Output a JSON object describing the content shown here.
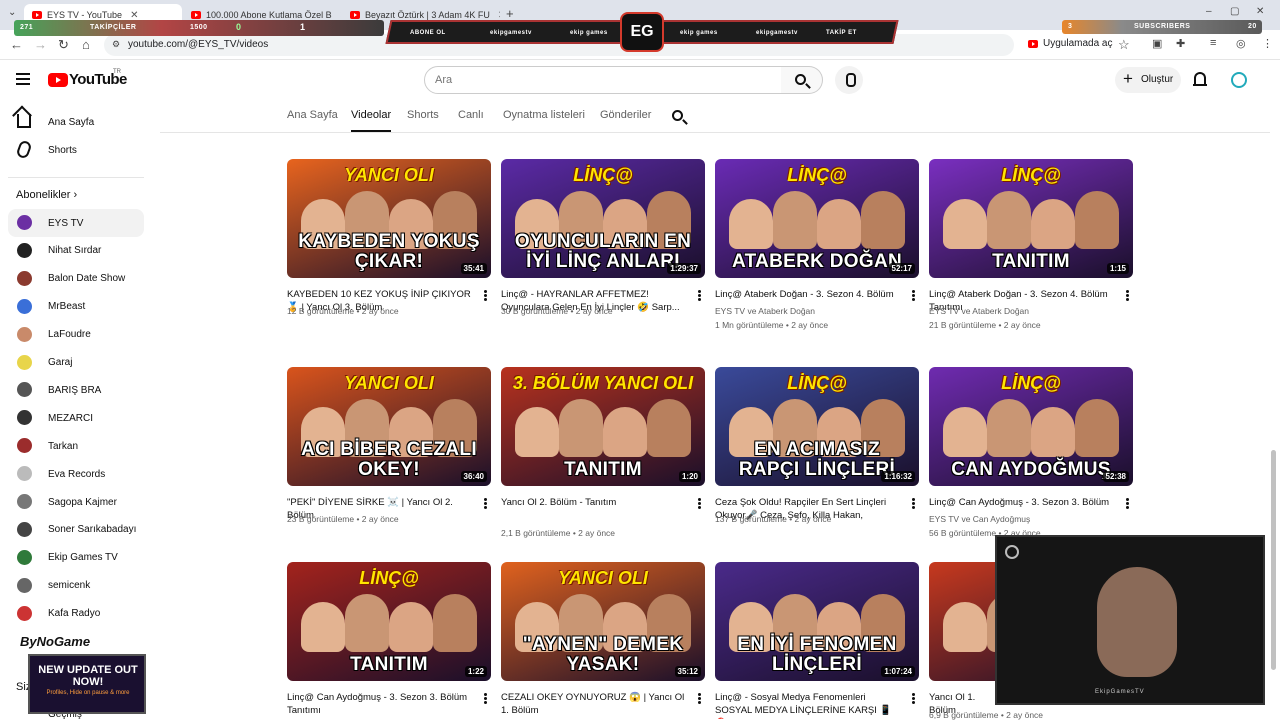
{
  "browser": {
    "tabs": [
      {
        "title": "EYS TV - YouTube",
        "active": true
      },
      {
        "title": "100.000 Abone Kutlama Özel B",
        "active": false
      },
      {
        "title": "Beyazıt Öztürk | 3 Adam 4K FU",
        "active": false
      }
    ],
    "new_tab": "+",
    "url": "youtube.com/@EYS_TV/videos",
    "app_button": "Uygulamada aç"
  },
  "overlay": {
    "followers_label": "TAKİPÇİLER",
    "followers_count": "1500",
    "followers_left": "271",
    "counter_a": "0",
    "counter_b": "1",
    "center_left": "ABONE OL",
    "center_items": [
      "ekipgamestv",
      "ekip games",
      "ekip games",
      "ekipgamestv"
    ],
    "center_right": "TAKİP ET",
    "logo": "EG",
    "subscribers_label": "SUBSCRIBERS",
    "subscribers_left": "3",
    "subscribers_count": "20"
  },
  "header": {
    "logo_text": "YouTube",
    "logo_sup": "TR",
    "search_placeholder": "Ara",
    "create_label": "Oluştur"
  },
  "sidebar": {
    "items": [
      {
        "label": "Ana Sayfa"
      },
      {
        "label": "Shorts"
      }
    ],
    "subscriptions_heading": "Abonelikler",
    "subscriptions": [
      {
        "label": "EYS TV",
        "color": "#6b2fa3",
        "active": true
      },
      {
        "label": "Nihat Sırdar",
        "color": "#222222"
      },
      {
        "label": "Balon Date Show",
        "color": "#8b3a2f"
      },
      {
        "label": "MrBeast",
        "color": "#3a6fd8"
      },
      {
        "label": "LaFoudre",
        "color": "#c98a6a"
      },
      {
        "label": "Garaj",
        "color": "#e8d54a"
      },
      {
        "label": "BARIŞ BRA",
        "color": "#555555"
      },
      {
        "label": "MEZARCI",
        "color": "#333333"
      },
      {
        "label": "Tarkan",
        "color": "#9b2c2c"
      },
      {
        "label": "Eva Records",
        "color": "#bbbbbb"
      },
      {
        "label": "Sagopa Kajmer",
        "color": "#777777"
      },
      {
        "label": "Soner Sarıkabadayı",
        "color": "#444444"
      },
      {
        "label": "Ekip Games TV",
        "color": "#2f7a3a"
      },
      {
        "label": "semicenk",
        "color": "#666666"
      },
      {
        "label": "Kafa Radyo",
        "color": "#cc3333"
      }
    ],
    "you_heading": "Siz",
    "history_label": "Geçmiş",
    "bynogame": "ByNoGame",
    "update_title": "NEW UPDATE OUT NOW!",
    "update_sub": "Profiles, Hide on pause & more"
  },
  "channel_tabs": [
    {
      "label": "Ana Sayfa",
      "active": false
    },
    {
      "label": "Videolar",
      "active": true
    },
    {
      "label": "Shorts",
      "active": false
    },
    {
      "label": "Canlı",
      "active": false
    },
    {
      "label": "Oynatma listeleri",
      "active": false
    },
    {
      "label": "Gönderiler",
      "active": false
    }
  ],
  "videos": [
    {
      "thumb_brand": "YANCI OLI",
      "thumb_title": "KAYBEDEN YOKUŞ ÇIKAR!",
      "bg": "#e8641e",
      "duration": "35:41",
      "title": "KAYBEDEN 10 KEZ YOKUŞ İNİP ÇIKIYOR 🏅 | Yancı Ol 3. Bölüm",
      "channel": "",
      "meta": "12 B görüntüleme • 2 ay önce"
    },
    {
      "thumb_brand": "LİNÇ@",
      "thumb_title": "OYUNCULARIN EN İYİ LİNÇ ANLARI",
      "bg": "#5b2aa6",
      "duration": "1:29:37",
      "title": "Linç@ - HAYRANLAR AFFETMEZ! Oyunculara Gelen En İyi Linçler 🤣 Sarp...",
      "channel": "",
      "meta": "30 B görüntüleme • 2 ay önce"
    },
    {
      "thumb_brand": "LİNÇ@",
      "thumb_title": "ATABERK DOĞAN",
      "bg": "#6a2bb5",
      "duration": "52:17",
      "title": "Linç@ Ataberk Doğan - 3. Sezon 4. Bölüm",
      "channel": "EYS TV ve Ataberk Doğan",
      "meta": "1 Mn görüntüleme • 2 ay önce"
    },
    {
      "thumb_brand": "LİNÇ@",
      "thumb_title": "TANITIM",
      "bg": "#7a2fc0",
      "duration": "1:15",
      "title": "Linç@ Ataberk Doğan - 3. Sezon 4. Bölüm Tanıtımı",
      "channel": "EYS TV ve Ataberk Doğan",
      "meta": "21 B görüntüleme • 2 ay önce"
    },
    {
      "thumb_brand": "YANCI OLI",
      "thumb_title": "ACI BİBER CEZALI OKEY!",
      "bg": "#d9541c",
      "duration": "36:40",
      "title": "\"PEKİ\" DİYENE SİRKE ☠️ | Yancı Ol 2. Bölüm",
      "channel": "",
      "meta": "23 B görüntüleme • 2 ay önce"
    },
    {
      "thumb_brand": "3. BÖLÜM YANCI OLI",
      "thumb_title": "TANITIM",
      "bg": "#b8321e",
      "duration": "1:20",
      "title": "Yancı Ol 2. Bölüm - Tanıtım",
      "channel": "",
      "meta": "2,1 B görüntüleme • 2 ay önce"
    },
    {
      "thumb_brand": "LİNÇ@",
      "thumb_title": "EN ACIMASIZ RAPÇI LİNÇLERİ",
      "bg": "#3a4a9a",
      "duration": "1:16:32",
      "title": "Ceza Şok Oldu! Rapçiler En Sert Linçleri Okuyor🎤 Ceza, Sefo, Killa Hakan, Güneş,...",
      "channel": "",
      "meta": "137 B görüntüleme • 2 ay önce"
    },
    {
      "thumb_brand": "LİNÇ@",
      "thumb_title": "CAN AYDOĞMUŞ",
      "bg": "#6f2bb0",
      "duration": "52:38",
      "title": "Linç@ Can Aydoğmuş - 3. Sezon 3. Bölüm",
      "channel": "EYS TV ve Can Aydoğmuş",
      "meta": "56 B görüntüleme • 2 ay önce"
    },
    {
      "thumb_brand": "LİNÇ@",
      "thumb_title": "TANITIM",
      "bg": "#a3231c",
      "duration": "1:22",
      "title": "Linç@ Can Aydoğmuş - 3. Sezon 3. Bölüm Tanıtımı",
      "channel": "",
      "meta": ""
    },
    {
      "thumb_brand": "YANCI OLI",
      "thumb_title": "\"AYNEN\" DEMEK YASAK!",
      "bg": "#e0621e",
      "duration": "35:12",
      "title": "CEZALI OKEY OYNUYORUZ 😱 | Yancı Ol 1. Bölüm",
      "channel": "",
      "meta": ""
    },
    {
      "thumb_brand": "",
      "thumb_title": "EN İYİ FENOMEN LİNÇLERİ",
      "bg": "#4a2a8a",
      "duration": "1:07:24",
      "title": "Linç@ - Sosyal Medya Fenomenleri SOSYAL MEDYA LİNÇLERİNE KARŞI 📱🎈",
      "channel": "",
      "meta": ""
    },
    {
      "thumb_brand": "",
      "thumb_title": "",
      "bg": "#c7391e",
      "duration": "",
      "title": "Yancı Ol 1. Bölüm",
      "channel": "",
      "meta": "6,9 B görüntüleme • 2 ay önce"
    }
  ],
  "webcam": {
    "tag": "EkipGamesTV"
  }
}
